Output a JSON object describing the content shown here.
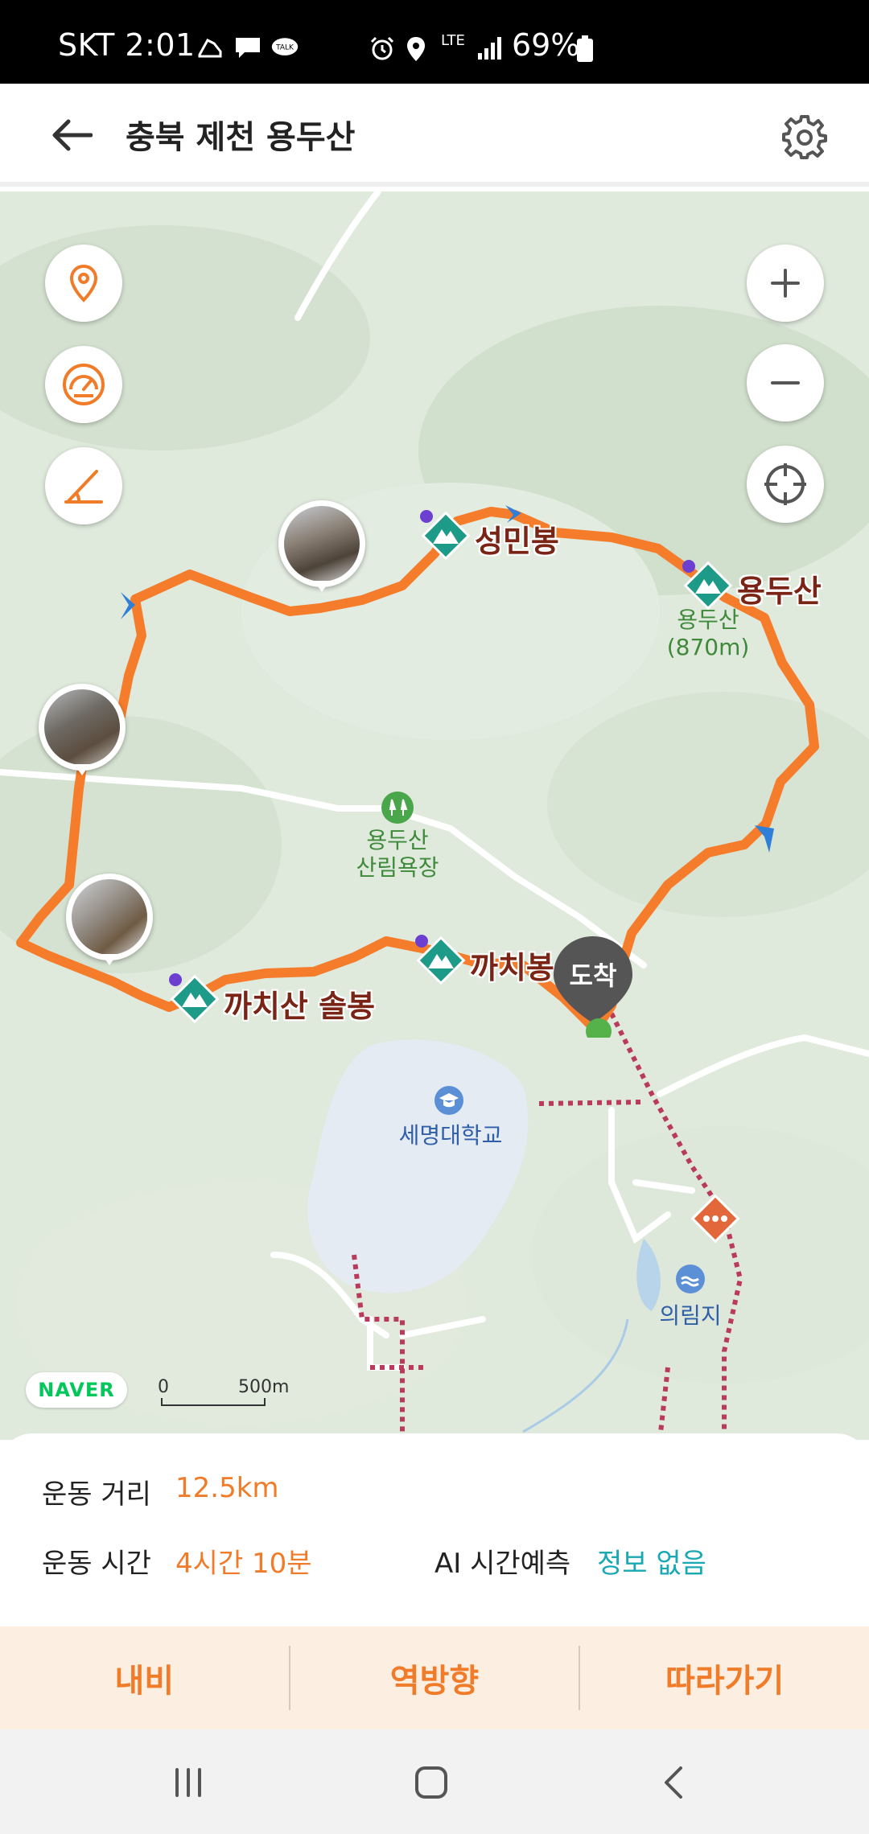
{
  "status_bar": {
    "carrier_time": "SKT 2:01",
    "network": "LTE",
    "battery": "69%"
  },
  "app_bar": {
    "title": "충북 제천 용두산"
  },
  "map": {
    "peaks": [
      {
        "name": "성민봉"
      },
      {
        "name": "용두산"
      },
      {
        "name": "까치봉"
      },
      {
        "name": "까치산 솔봉"
      }
    ],
    "summit_label_line1": "용두산",
    "summit_label_line2": "(870m)",
    "forest_line1": "용두산",
    "forest_line2": "산림욕장",
    "university": "세명대학교",
    "reservoir": "의림지",
    "arrival_label": "도착",
    "brand": "NAVER",
    "scale_zero": "0",
    "scale_distance": "500m",
    "route_color": "#f47c2a",
    "peak_marker_color": "#1d9a88"
  },
  "stats": {
    "distance_label": "운동 거리",
    "distance_value": "12.5km",
    "time_label": "운동 시간",
    "time_value": "4시간 10분",
    "ai_label": "AI 시간예측",
    "ai_value": "정보 없음"
  },
  "actions": {
    "navi": "내비",
    "reverse": "역방향",
    "follow": "따라가기"
  },
  "colors": {
    "accent": "#f07b28",
    "teal": "#1aa8b4",
    "action_bg": "#fdeee2"
  }
}
